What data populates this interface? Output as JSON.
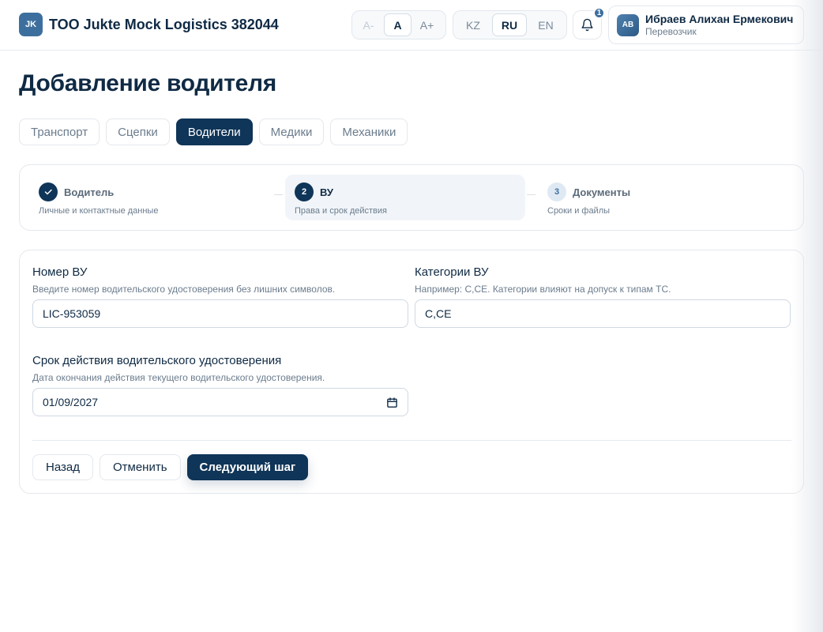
{
  "header": {
    "logo_text": "JK",
    "company_name": "TOO Jukte Mock Logistics 382044",
    "font_size_controls": [
      "A-",
      "A",
      "A+"
    ],
    "languages": [
      "KZ",
      "RU",
      "EN"
    ],
    "notification_count": "1",
    "user": {
      "initials": "AB",
      "name": "Ибраев Алихан Ермекович",
      "role": "Перевозчик"
    }
  },
  "page_title": "Добавление водителя",
  "tabs": [
    "Транспорт",
    "Сцепки",
    "Водители",
    "Медики",
    "Механики"
  ],
  "active_tab": "Водители",
  "stepper": {
    "steps": [
      {
        "number": "1",
        "title": "Водитель",
        "subtitle": "Личные и контактные данные",
        "status": "done"
      },
      {
        "number": "2",
        "title": "ВУ",
        "subtitle": "Права и срок действия",
        "status": "current"
      },
      {
        "number": "3",
        "title": "Документы",
        "subtitle": "Сроки и файлы",
        "status": "pending"
      }
    ]
  },
  "form": {
    "license_number": {
      "label": "Номер ВУ",
      "help": "Введите номер водительского удостоверения без лишних символов.",
      "value": "LIC-953059"
    },
    "license_categories": {
      "label": "Категории ВУ",
      "help": "Например: C,CE. Категории влияют на допуск к типам ТС.",
      "value": "C,CE"
    },
    "license_expiry": {
      "label": "Срок действия водительского удостоверения",
      "help": "Дата окончания действия текущего водительского удостоверения.",
      "value": "01/09/2027"
    }
  },
  "actions": {
    "back": "Назад",
    "cancel": "Отменить",
    "next": "Следующий шаг"
  },
  "colors": {
    "primary": "#0f3558",
    "accent": "#3d6f9e",
    "border": "#e3e8ee",
    "muted_text": "#6b7c8d"
  }
}
